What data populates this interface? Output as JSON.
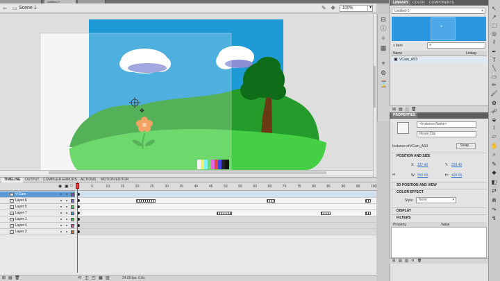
{
  "document": {
    "tabs": [
      "",
      "Untitled-1*",
      ""
    ],
    "scene": "Scene 1",
    "zoom": "100%"
  },
  "timeline": {
    "tabs": [
      "TIMELINE",
      "OUTPUT",
      "COMPILER ERRORS",
      "ACTIONS",
      "MOTION EDITOR"
    ],
    "frame_numbers": [
      "1",
      "5",
      "10",
      "15",
      "20",
      "25",
      "30",
      "35",
      "40",
      "45",
      "50",
      "55",
      "60",
      "65",
      "70",
      "75",
      "80",
      "85",
      "90",
      "95",
      "100"
    ],
    "layers": [
      {
        "name": "V-Cam",
        "color": "#8a3fd1"
      },
      {
        "name": "Layer 6",
        "color": "#7a7ad6"
      },
      {
        "name": "Layer 5",
        "color": "#3fd14f"
      },
      {
        "name": "Layer 7",
        "color": "#3fa0d1"
      },
      {
        "name": "Layer 1",
        "color": "#3fd14f"
      },
      {
        "name": "Layer 4",
        "color": "#d14fb0"
      },
      {
        "name": "Layer 2",
        "color": "#d17b3f"
      }
    ],
    "fps": "24.00",
    "fps_unit": "fps",
    "time": "0.0s"
  },
  "library": {
    "tabs": [
      "LIBRARY",
      "COLOR",
      "COMPONENTS"
    ],
    "document": "Untitled-1",
    "count": "1 item",
    "col_name": "Name",
    "col_linkage": "Linkag",
    "item": "VCam_AS3"
  },
  "properties": {
    "tab": "PROPERTIES",
    "instance_name_placeholder": "<Instance Name>",
    "type": "Movie Clip",
    "instance_of_label": "Instance of:",
    "instance_of": "VCam_AS3",
    "swap": "Swap...",
    "pos_size": "POSITION AND SIZE",
    "x_label": "X:",
    "x": "127.40",
    "y_label": "Y:",
    "y": "229.40",
    "w_label": "W:",
    "w": "550.00",
    "h_label": "H:",
    "h": "400.00",
    "three_d": "3D POSITION AND VIEW",
    "color_effect": "COLOR EFFECT",
    "style_label": "Style:",
    "style": "None",
    "display": "DISPLAY",
    "filters": "FILTERS",
    "filter_property": "Property",
    "filter_value": "Value"
  },
  "colors": {
    "sky": "#1e9ad6",
    "hill_dark": "#249b2a",
    "hill_light": "#37c43c",
    "grass": "#44cf44",
    "tree_green": "#0f6d1a",
    "trunk": "#6b3a14",
    "flower": "#f28a3a",
    "selection": "#5b9bd5"
  }
}
